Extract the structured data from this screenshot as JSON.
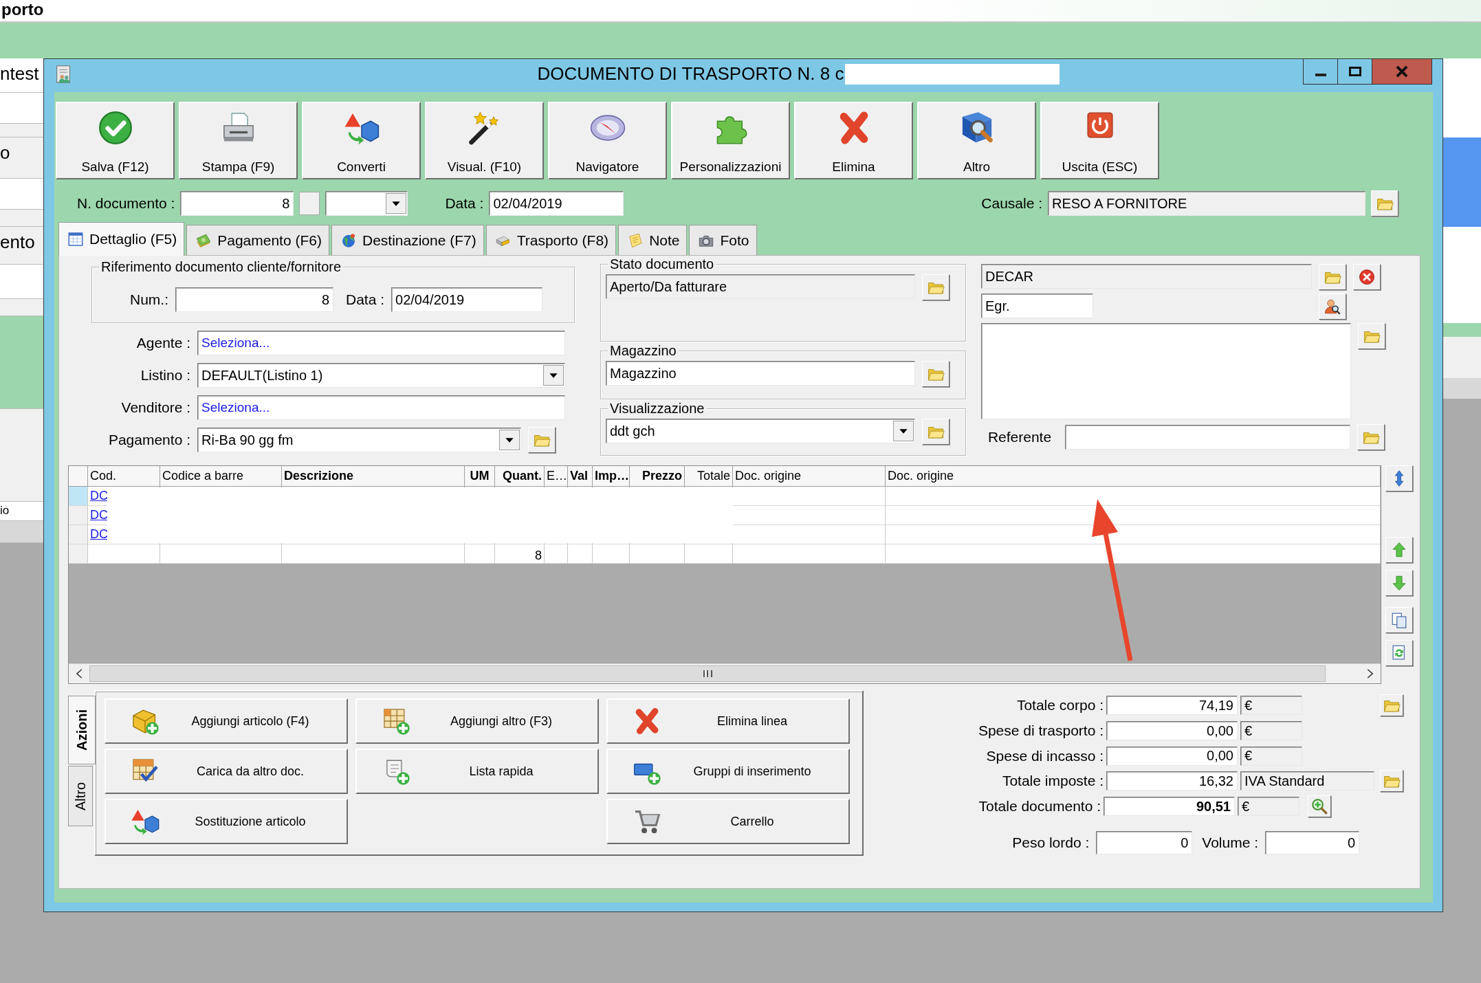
{
  "background_app": {
    "title_fragment": "porto",
    "labels": [
      "ntest",
      "o",
      "ento",
      "io"
    ]
  },
  "window": {
    "title": "DOCUMENTO DI TRASPORTO N. 8 c"
  },
  "toolbar": [
    "Salva (F12)",
    "Stampa (F9)",
    "Converti",
    "Visual. (F10)",
    "Navigatore",
    "Personalizzazioni",
    "Elimina",
    "Altro",
    "Uscita (ESC)"
  ],
  "header": {
    "doc_number_label": "N. documento :",
    "doc_number": "8",
    "date_label": "Data :",
    "date": "02/04/2019",
    "causale_label": "Causale :",
    "causale": "RESO A FORNITORE"
  },
  "tabs": [
    {
      "label": "Dettaglio (F5)",
      "selected": true
    },
    {
      "label": "Pagamento (F6)",
      "selected": false
    },
    {
      "label": "Destinazione (F7)",
      "selected": false
    },
    {
      "label": "Trasporto (F8)",
      "selected": false
    },
    {
      "label": "Note",
      "selected": false
    },
    {
      "label": "Foto",
      "selected": false
    }
  ],
  "reference": {
    "legend": "Riferimento documento cliente/fornitore",
    "num_label": "Num.:",
    "num": "8",
    "date_label": "Data :",
    "date": "02/04/2019"
  },
  "fields": [
    {
      "label": "Agente :",
      "value": "Seleziona...",
      "kind": "link"
    },
    {
      "label": "Listino :",
      "value": "DEFAULT(Listino 1)",
      "kind": "dropdown"
    },
    {
      "label": "Venditore :",
      "value": "Seleziona...",
      "kind": "link"
    },
    {
      "label": "Pagamento :",
      "value": "Ri-Ba 90 gg fm",
      "kind": "dropdown_folder"
    }
  ],
  "status_groups": [
    {
      "legend": "Stato documento",
      "value": "Aperto/Da fatturare",
      "kind": "readonly"
    },
    {
      "legend": "Magazzino",
      "value": "Magazzino",
      "kind": "text"
    },
    {
      "legend": "Visualizzazione",
      "value": "ddt gch",
      "kind": "dropdown"
    }
  ],
  "customer": {
    "name": "DECAR",
    "salutation": "Egr.",
    "referente_label": "Referente"
  },
  "table": {
    "columns": [
      {
        "label": "Cod.",
        "bold": false
      },
      {
        "label": "Codice a barre",
        "bold": false
      },
      {
        "label": "Descrizione",
        "bold": true
      },
      {
        "label": "UM",
        "bold": true
      },
      {
        "label": "Quant.",
        "bold": true
      },
      {
        "label": "E…",
        "bold": false
      },
      {
        "label": "Val",
        "bold": true
      },
      {
        "label": "Imp…",
        "bold": true
      },
      {
        "label": "Prezzo",
        "bold": true
      },
      {
        "label": "Totale",
        "bold": false
      },
      {
        "label": "Doc. origine",
        "bold": false
      },
      {
        "label": "Doc. origine",
        "bold": false
      }
    ],
    "rows": [
      {
        "selected": true,
        "cod": "DC"
      },
      {
        "selected": false,
        "cod": "DC"
      },
      {
        "selected": false,
        "cod": "DC"
      },
      {
        "selected": false,
        "quant": "8"
      }
    ]
  },
  "actions": {
    "tabs": [
      {
        "label": "Azioni",
        "selected": true
      },
      {
        "label": "Altro",
        "selected": false
      }
    ],
    "columns": [
      [
        "Aggiungi articolo (F4)",
        "Carica da altro doc.",
        "Sostituzione articolo"
      ],
      [
        "Aggiungi altro (F3)",
        "Lista rapida"
      ],
      [
        "Elimina linea",
        "Gruppi di inserimento",
        "Carrello"
      ]
    ]
  },
  "totals": [
    {
      "label": "Totale corpo :",
      "value": "74,19",
      "unit": "€",
      "bold": false
    },
    {
      "label": "Spese di trasporto :",
      "value": "0,00",
      "unit": "€",
      "bold": false
    },
    {
      "label": "Spese di incasso :",
      "value": "0,00",
      "unit": "€",
      "bold": false
    },
    {
      "label": "Totale imposte :",
      "value": "16,32",
      "unit": "IVA Standard",
      "bold": false
    },
    {
      "label": "Totale documento :",
      "value": "90,51",
      "unit": "€",
      "bold": true
    }
  ],
  "weights": {
    "peso_label": "Peso lordo :",
    "peso": "0",
    "volume_label": "Volume :",
    "volume": "0"
  }
}
